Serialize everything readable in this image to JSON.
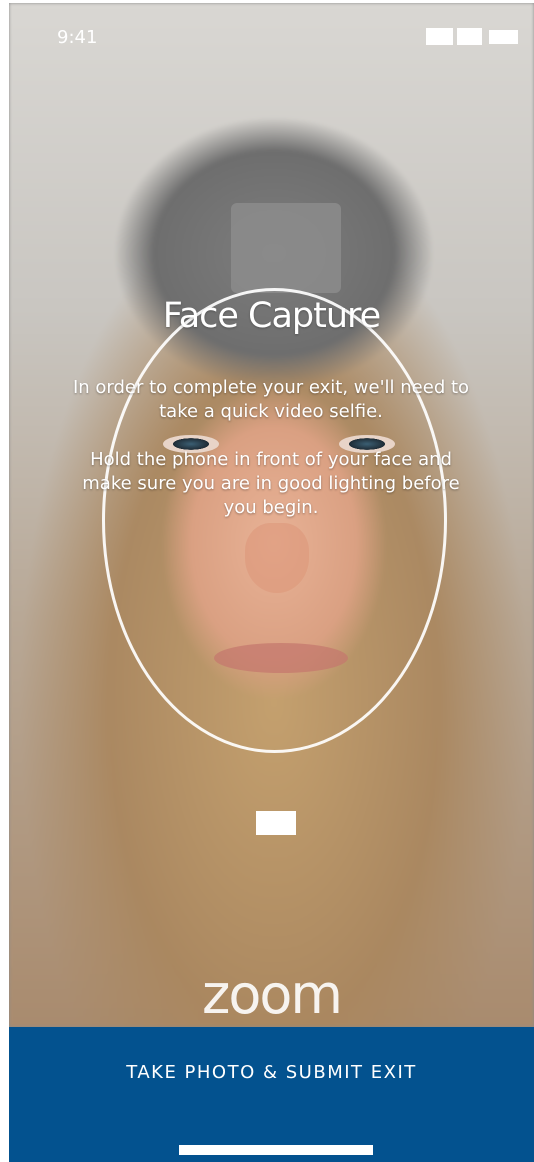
{
  "status_bar": {
    "time": "9:41",
    "icons": [
      "signal-icon",
      "wifi-icon",
      "battery-icon"
    ]
  },
  "screen": {
    "title": "Face Capture",
    "instructions": [
      "In order to complete your exit, we'll need to take a quick video selfie.",
      "Hold the phone in front of your face and make sure you are in good lighting before you begin."
    ],
    "logo_text": "zoom"
  },
  "action": {
    "label": "TAKE PHOTO & SUBMIT EXIT"
  },
  "colors": {
    "action_bar": "#03528f",
    "text": "#ffffff"
  }
}
